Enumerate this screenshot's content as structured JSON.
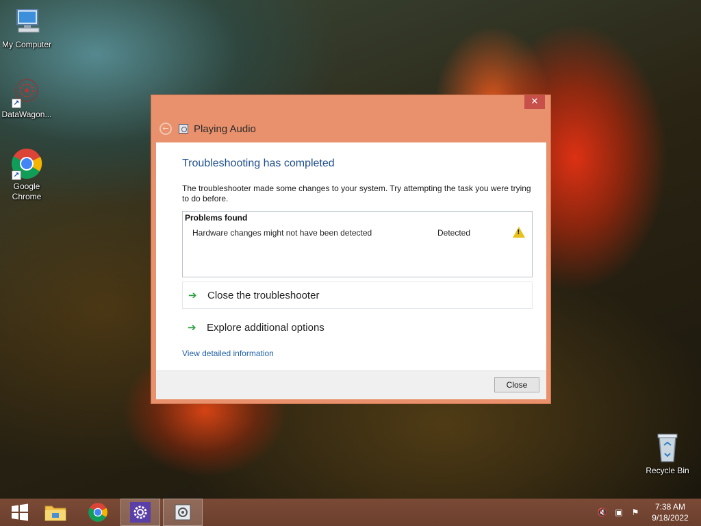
{
  "desktop": {
    "icons": [
      {
        "label": "My Computer"
      },
      {
        "label": "DataWagon..."
      },
      {
        "label": "Google Chrome"
      },
      {
        "label": "Recycle Bin"
      }
    ]
  },
  "window": {
    "title": "Playing Audio",
    "close_glyph": "✕",
    "heading": "Troubleshooting has completed",
    "description": "The troubleshooter made some changes to your system. Try attempting the task you were trying to do before.",
    "problems": {
      "header": "Problems found",
      "items": [
        {
          "name": "Hardware changes might not have been detected",
          "status": "Detected",
          "icon": "warning-icon"
        }
      ]
    },
    "options": [
      {
        "label": "Close the troubleshooter"
      },
      {
        "label": "Explore additional options"
      }
    ],
    "details_link": "View detailed information",
    "close_button": "Close"
  },
  "taskbar": {
    "items": [
      "start-icon",
      "file-explorer-icon",
      "chrome-icon",
      "settings-icon",
      "troubleshooter-icon"
    ],
    "clock": {
      "time": "7:38 AM",
      "date": "9/18/2022"
    }
  },
  "colors": {
    "window_frame": "#e8916c",
    "heading": "#1e4e8c",
    "link": "#1f5fa8",
    "close_button_bg": "#c7504a",
    "taskbar": "#6b3f2d"
  }
}
